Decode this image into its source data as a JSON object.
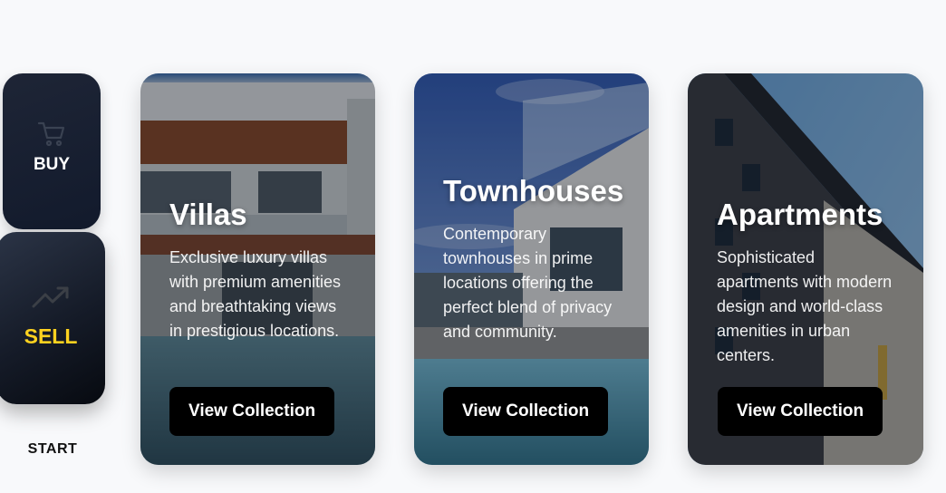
{
  "rail": {
    "buy": {
      "label": "BUY",
      "icon": "cart-icon"
    },
    "sell": {
      "label": "SELL",
      "icon": "trending-up-icon",
      "accent": "#ffd21f"
    },
    "start_label": "START"
  },
  "cards": [
    {
      "title": "Villas",
      "description": "Exclusive luxury villas with premium amenities and breathtaking views in prestigious locations.",
      "button_label": "View Collection"
    },
    {
      "title": "Townhouses",
      "description": "Contemporary townhouses in prime locations offering the perfect blend of privacy and community.",
      "button_label": "View Collection"
    },
    {
      "title": "Apartments",
      "description": "Sophisticated apartments with modern design and world-class amenities in urban centers.",
      "button_label": "View Collection"
    }
  ]
}
